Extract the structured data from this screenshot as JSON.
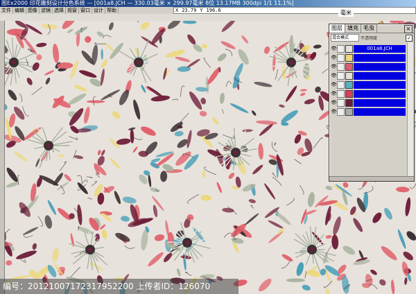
{
  "window": {
    "title": "图Ex2000  印花雕刻设计分色系统 — [001a8.JCH — 330.03毫米 × 299.97毫米 8位 13.17MB 300dpi 1/1 11.1%]"
  },
  "menu": [
    "文件",
    "编辑",
    "图像",
    "滤镜",
    "选择",
    "视窗",
    "窗口",
    "设计",
    "帮助"
  ],
  "coords": {
    "x_label": "X",
    "x": "23.79",
    "y_label": "Y",
    "y": "196.6"
  },
  "unit": "毫米",
  "layers_panel": {
    "tabs": [
      "图层",
      "填充",
      "毛虫"
    ],
    "close_label": "×",
    "blend_mode": "混合模式",
    "opacity": "不透明度",
    "layers": [
      {
        "name": "001a8.JCH",
        "swatch": "#e8e2dc"
      },
      {
        "name": "",
        "swatch": "#f0d878"
      },
      {
        "name": "",
        "swatch": "#d86070"
      },
      {
        "name": "",
        "swatch": "#e8e0d8"
      },
      {
        "name": "",
        "swatch": "#58b0c0"
      },
      {
        "name": "",
        "swatch": "#d84058"
      },
      {
        "name": "",
        "swatch": "#6a2038"
      },
      {
        "name": "",
        "swatch": "#a8b0a8"
      }
    ]
  },
  "watermark": "编号：20121007172317952200 上传者ID：126070",
  "palette": {
    "maroon": "#6e1f3a",
    "coral": "#e0606a",
    "teal": "#4aa0b8",
    "yellow": "#ecd87a",
    "sage": "#a8b4a0",
    "cream": "#e8e2dc",
    "dark": "#3a3034"
  }
}
